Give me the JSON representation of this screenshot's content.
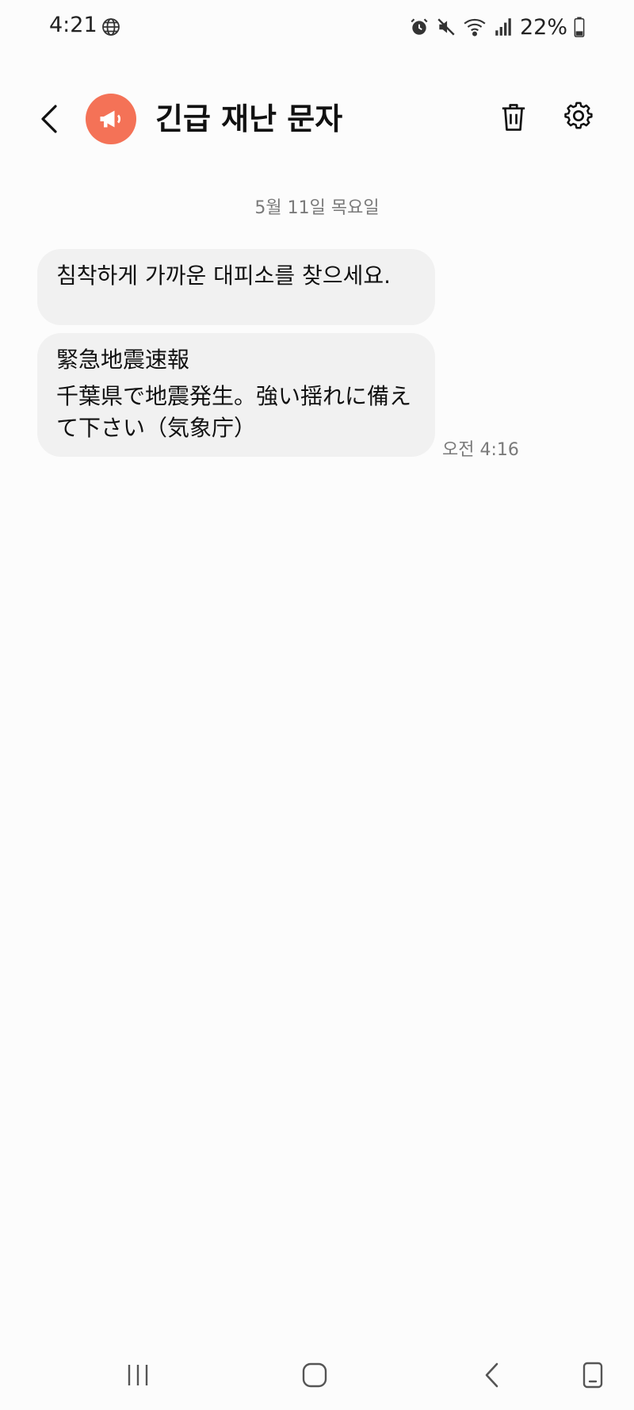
{
  "status_bar": {
    "time": "4:21",
    "battery": "22%",
    "icons": [
      "globe-icon",
      "alarm-icon",
      "mute-icon",
      "wifi-icon",
      "signal-icon",
      "battery-icon"
    ]
  },
  "header": {
    "title": "긴급 재난 문자",
    "back_icon": "back-arrow-icon",
    "avatar_icon": "megaphone-icon",
    "delete_icon": "trash-icon",
    "settings_icon": "gear-icon",
    "avatar_color": "#f47257"
  },
  "conversation": {
    "date": "5월 11일 목요일",
    "messages": [
      {
        "text": "침착하게 가까운 대피소를 찾으세요."
      },
      {
        "title": "緊急地震速報",
        "text": "千葉県で地震発生。強い揺れに備えて下さい（気象庁）",
        "time": "오전 4:16"
      }
    ]
  },
  "navigation": {
    "icons": [
      "recents-icon",
      "home-icon",
      "nav-back-icon",
      "rotate-icon"
    ]
  }
}
